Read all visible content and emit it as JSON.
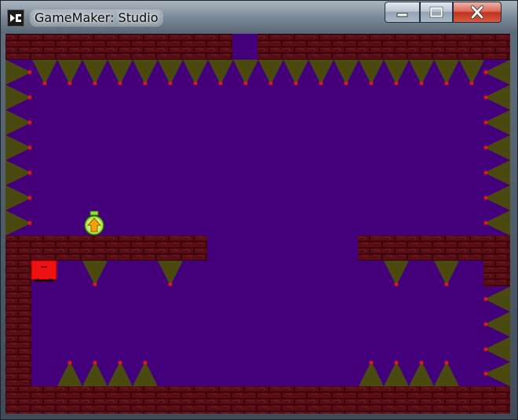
{
  "window": {
    "title": "GameMaker: Studio",
    "icon": "gamemaker-logo-icon"
  },
  "caption_buttons": [
    {
      "name": "minimize",
      "icon": "minimize-icon"
    },
    {
      "name": "maximize",
      "icon": "maximize-icon"
    },
    {
      "name": "close",
      "icon": "close-icon"
    }
  ],
  "colors": {
    "background": "#44007a",
    "brick": "#5a0d14",
    "brick_mortar": "#2a0408",
    "brick_accent": "#7a1a22",
    "spike": "#4a4a10",
    "spike_tip": "#e01818",
    "player": "#ee1111",
    "powerup_ring": "#7fd31f",
    "powerup_arrow": "#f4a10a"
  },
  "game": {
    "player": {
      "icon": "red-block-player"
    },
    "powerup": {
      "icon": "green-up-arrow-powerup"
    }
  }
}
